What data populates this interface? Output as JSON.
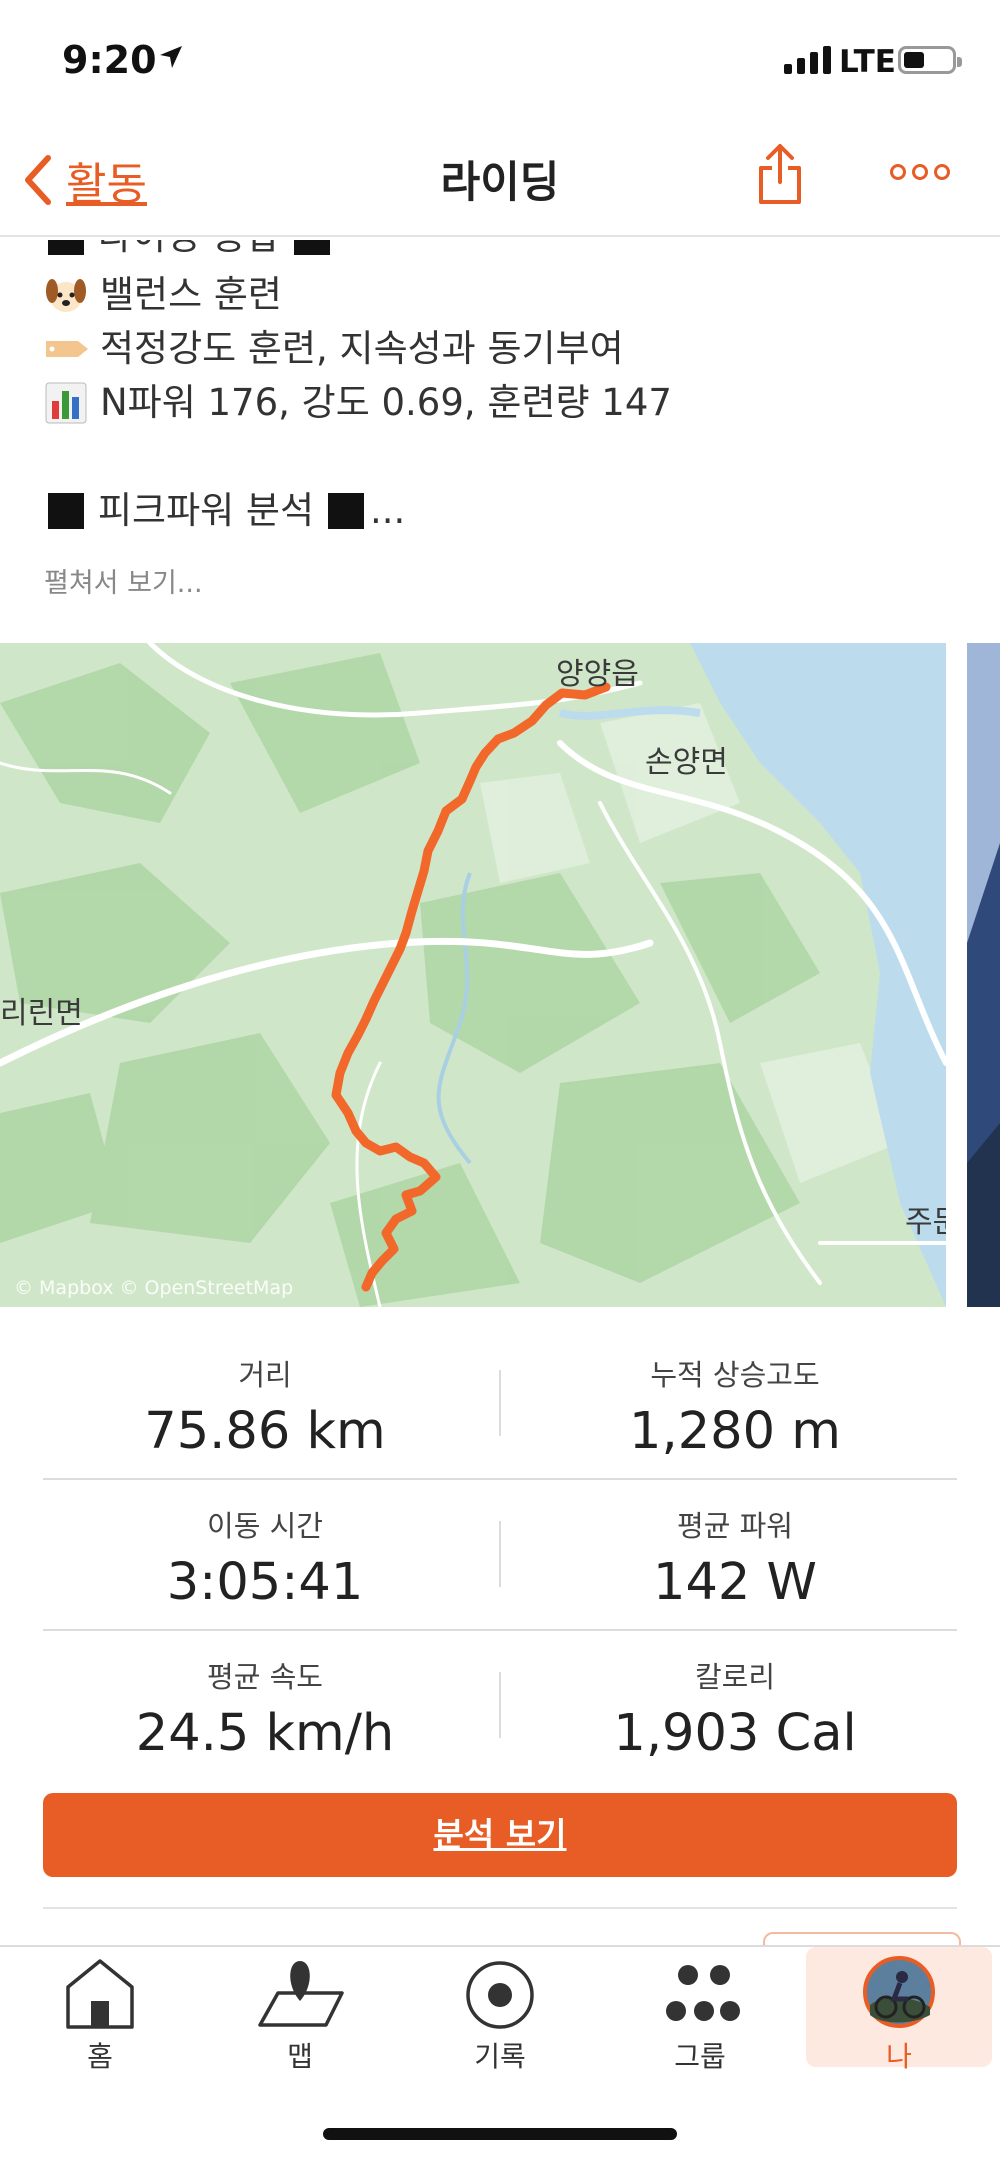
{
  "status_bar": {
    "time": "9:20",
    "network": "LTE"
  },
  "nav": {
    "back_label": "활동",
    "title": "라이딩"
  },
  "description": {
    "line0": "라이딩 종합",
    "line1": "밸런스 훈련",
    "line2": "적정강도 훈련, 지속성과 동기부여",
    "line3": "N파워 176, 강도 0.69, 훈련량 147",
    "line4": "피크파워 분석",
    "line4_suffix": "...",
    "expand_label": "펼쳐서 보기..."
  },
  "map": {
    "labels": {
      "town1": "양양읍",
      "town2": "손양면",
      "town3": "리린면",
      "town4": "주문"
    },
    "attribution": "© Mapbox © OpenStreetMap",
    "route_color": "#f2672a"
  },
  "stats": [
    {
      "label": "거리",
      "value": "75.86 km"
    },
    {
      "label": "누적 상승고도",
      "value": "1,280 m"
    },
    {
      "label": "이동 시간",
      "value": "3:05:41"
    },
    {
      "label": "평균 파워",
      "value": "142 W"
    },
    {
      "label": "평균 속도",
      "value": "24.5 km/h"
    },
    {
      "label": "칼로리",
      "value": "1,903 Cal"
    }
  ],
  "analysis_button": "분석 보기",
  "tabs": [
    {
      "label": "홈",
      "icon": "home-icon"
    },
    {
      "label": "맵",
      "icon": "map-pin-icon"
    },
    {
      "label": "기록",
      "icon": "record-icon"
    },
    {
      "label": "그룹",
      "icon": "group-icon"
    },
    {
      "label": "나",
      "icon": "avatar"
    }
  ],
  "colors": {
    "accent": "#e85d25",
    "map_land": "#cfe7c8",
    "map_water": "#bcdcee"
  }
}
